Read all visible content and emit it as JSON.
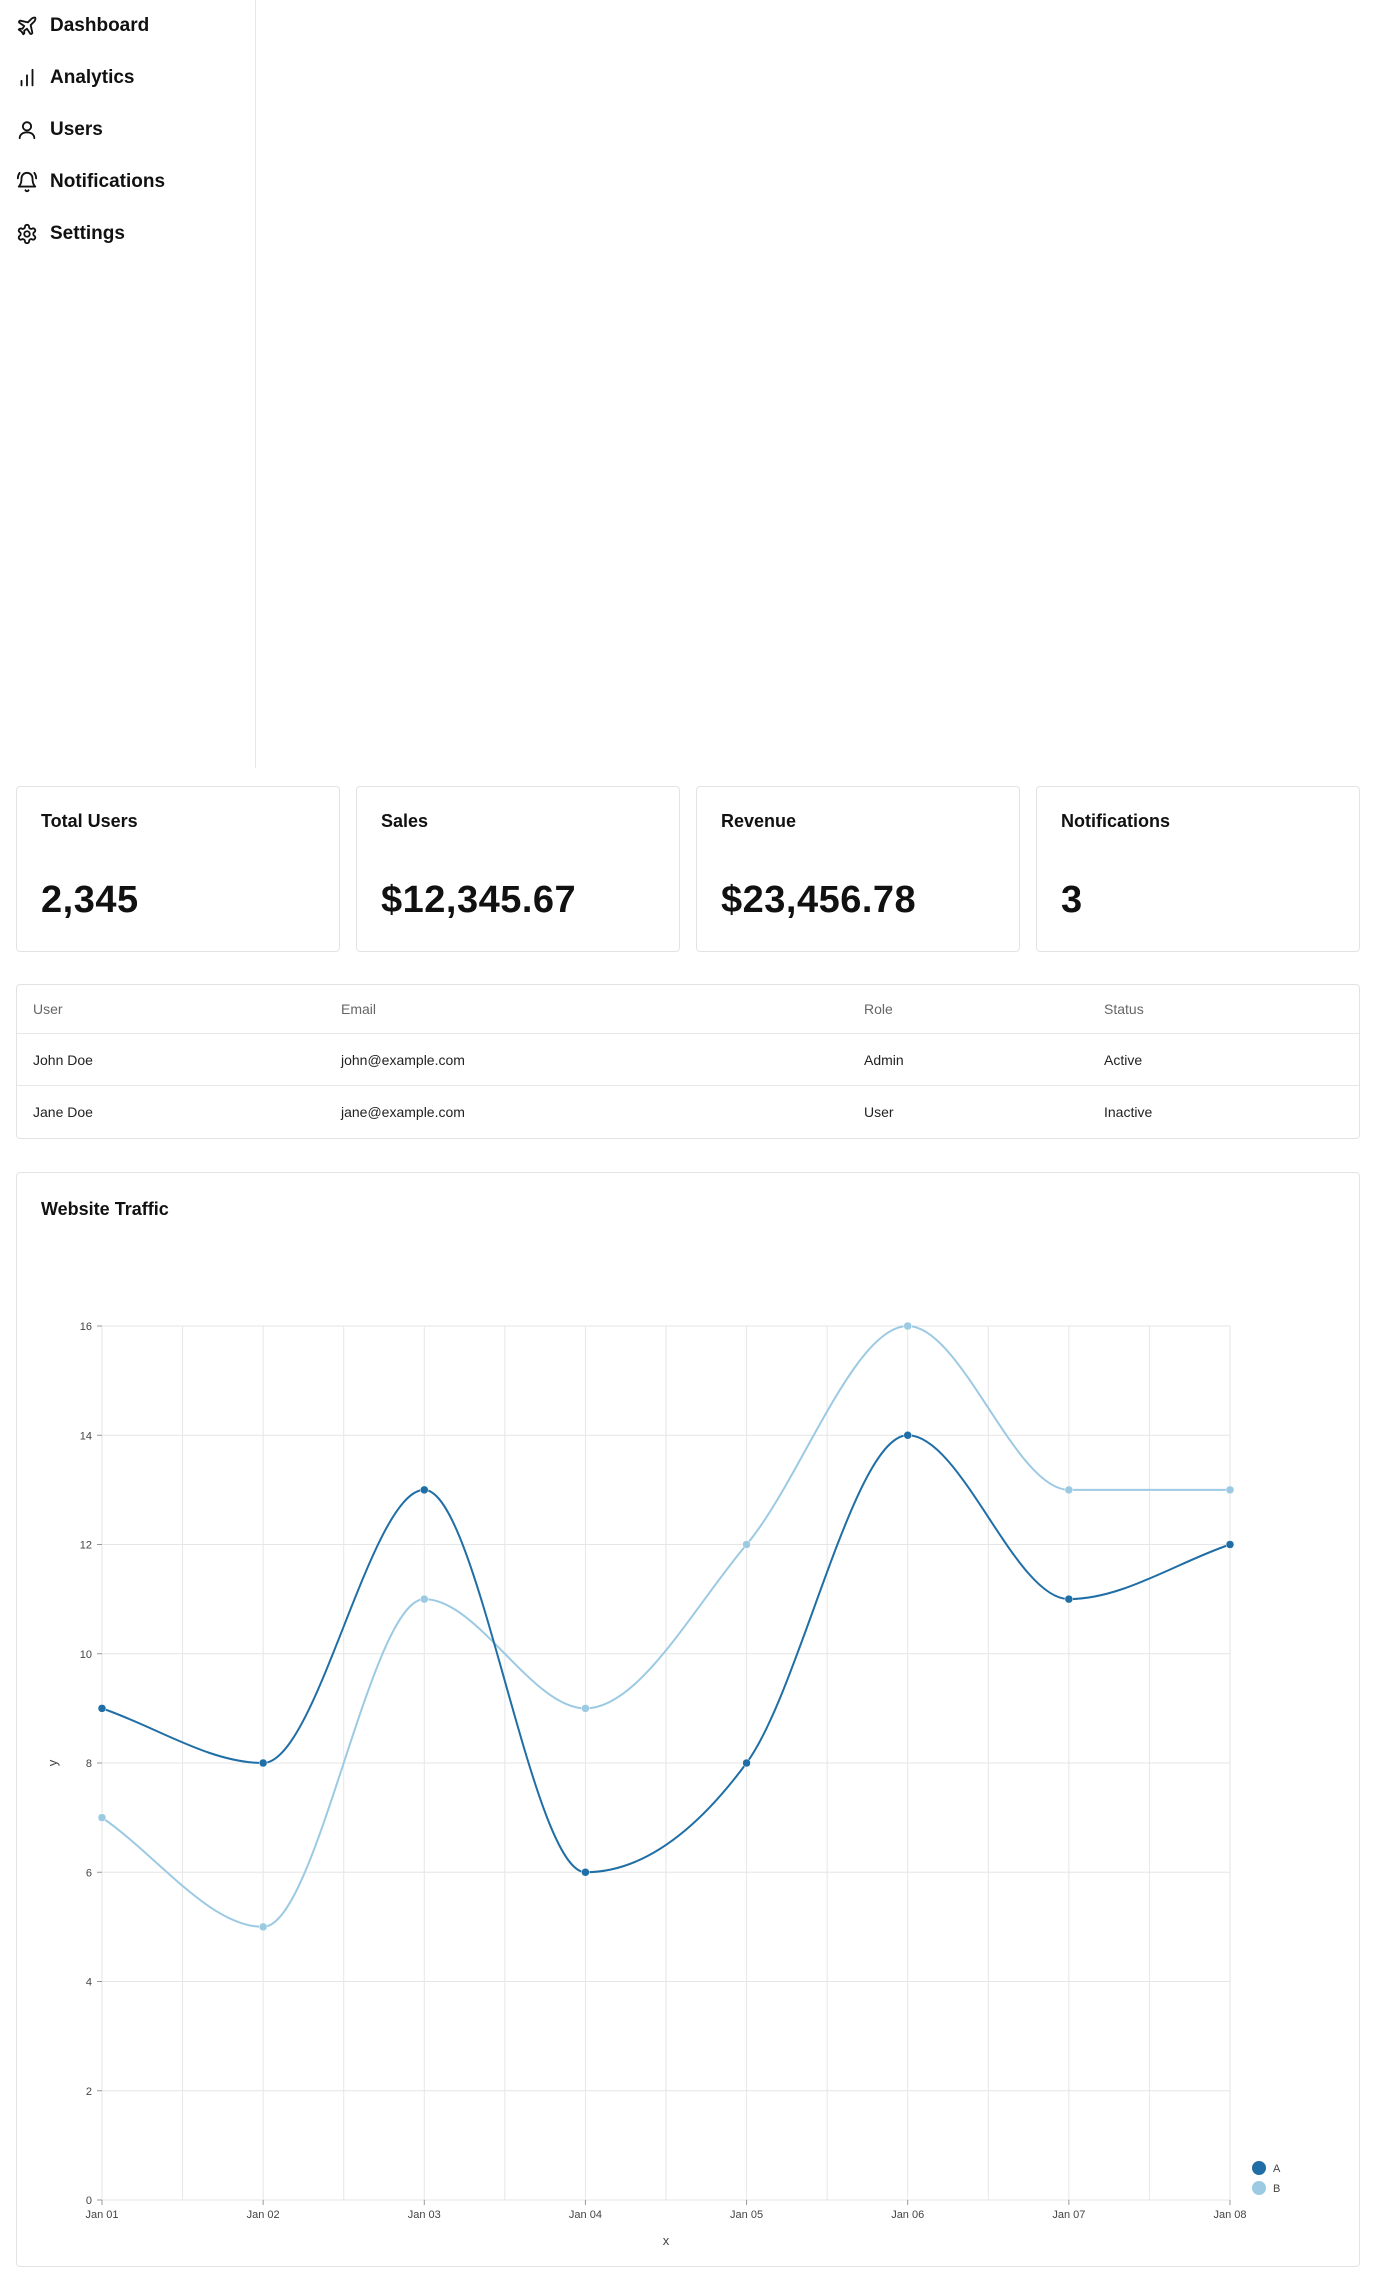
{
  "sidebar": {
    "items": [
      {
        "label": "Dashboard",
        "icon": "rocket-icon"
      },
      {
        "label": "Analytics",
        "icon": "bar-chart-icon"
      },
      {
        "label": "Users",
        "icon": "user-icon"
      },
      {
        "label": "Notifications",
        "icon": "bell-icon"
      },
      {
        "label": "Settings",
        "icon": "gear-icon"
      }
    ]
  },
  "stats": [
    {
      "title": "Total Users",
      "value": "2,345"
    },
    {
      "title": "Sales",
      "value": "$12,345.67"
    },
    {
      "title": "Revenue",
      "value": "$23,456.78"
    },
    {
      "title": "Notifications",
      "value": "3"
    }
  ],
  "table": {
    "headers": [
      "User",
      "Email",
      "Role",
      "Status"
    ],
    "rows": [
      [
        "John Doe",
        "john@example.com",
        "Admin",
        "Active"
      ],
      [
        "Jane Doe",
        "jane@example.com",
        "User",
        "Inactive"
      ]
    ]
  },
  "chart_title": "Website Traffic",
  "colors": {
    "series_a": "#1f6ea5",
    "series_b": "#9ccae3",
    "grid": "#e6e6e6",
    "border": "#e3e3e3"
  },
  "chart_data": {
    "type": "line",
    "title": "Website Traffic",
    "xlabel": "x",
    "ylabel": "y",
    "categories": [
      "Jan 01",
      "Jan 02",
      "Jan 03",
      "Jan 04",
      "Jan 05",
      "Jan 06",
      "Jan 07",
      "Jan 08"
    ],
    "ylim": [
      0,
      16
    ],
    "yticks": [
      0,
      2,
      4,
      6,
      8,
      10,
      12,
      14,
      16
    ],
    "grid": true,
    "legend_position": "bottom-right",
    "series": [
      {
        "name": "A",
        "values": [
          9,
          8,
          13,
          6,
          8,
          14,
          11,
          12
        ]
      },
      {
        "name": "B",
        "values": [
          7,
          5,
          11,
          9,
          12,
          16,
          13,
          13
        ]
      }
    ]
  }
}
